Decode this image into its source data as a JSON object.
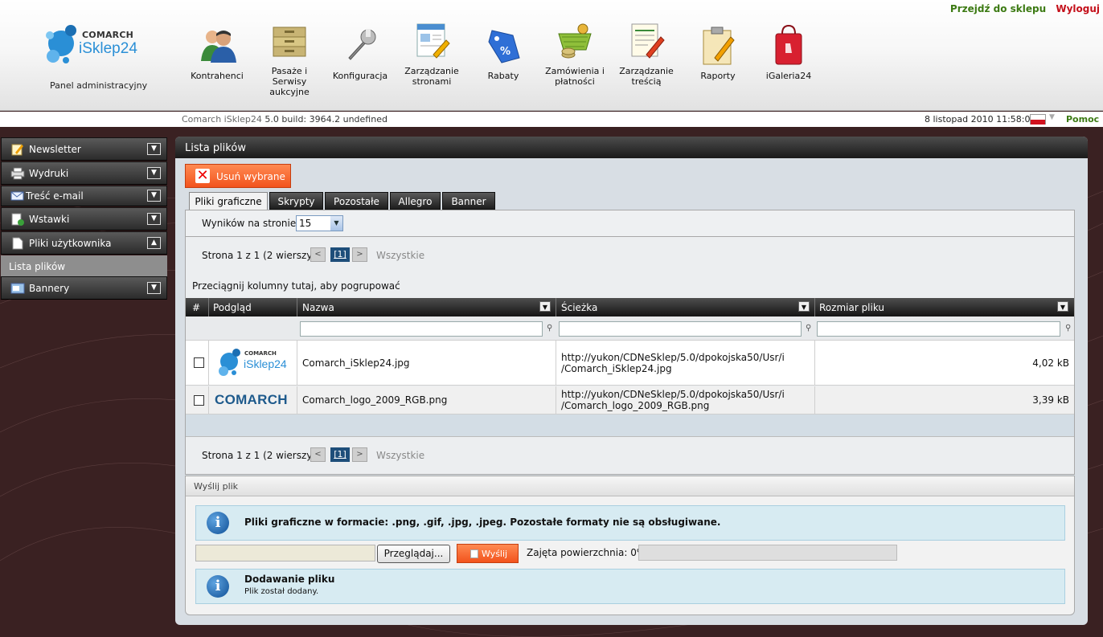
{
  "header": {
    "go_to_shop": "Przejdź do sklepu",
    "logout": "Wyloguj",
    "logo_brand": "COMARCH",
    "logo_name": "iSklep24",
    "panel_label": "Panel administracyjny"
  },
  "toolbar": [
    {
      "label": "Kontrahenci",
      "icon": "contacts-icon"
    },
    {
      "label": "Pasaże i Serwisy aukcyjne",
      "icon": "archive-icon"
    },
    {
      "label": "Konfiguracja",
      "icon": "wrench-icon"
    },
    {
      "label": "Zarządzanie stronami",
      "icon": "page-edit-icon"
    },
    {
      "label": "Rabaty",
      "icon": "discount-tag-icon"
    },
    {
      "label": "Zamówienia i płatności",
      "icon": "basket-icon"
    },
    {
      "label": "Zarządzanie treścią",
      "icon": "content-edit-icon"
    },
    {
      "label": "Raporty",
      "icon": "clipboard-icon"
    },
    {
      "label": "iGaleria24",
      "icon": "shopping-bag-icon"
    }
  ],
  "infobar": {
    "build_product": "Comarch iSklep24",
    "build_version": "5.0 build: 3964.2  undefined",
    "datetime": "8 listopad 2010 11:58:07",
    "help": "Pomoc"
  },
  "sidebar": {
    "items": [
      {
        "label": "Newsletter",
        "icon": "newsletter-icon",
        "expanded": false
      },
      {
        "label": "Wydruki",
        "icon": "printer-icon",
        "expanded": false
      },
      {
        "label": "Treść e-mail",
        "icon": "envelope-icon",
        "expanded": false
      },
      {
        "label": "Wstawki",
        "icon": "insert-icon",
        "expanded": false
      },
      {
        "label": "Pliki użytkownika",
        "icon": "file-icon",
        "expanded": true
      },
      {
        "label": "Bannery",
        "icon": "banner-icon",
        "expanded": false
      }
    ],
    "subitem": "Lista plików"
  },
  "main": {
    "title": "Lista plików",
    "delete_button": "Usuń wybrane",
    "tabs": [
      "Pliki graficzne",
      "Skrypty",
      "Pozostałe",
      "Allegro",
      "Banner"
    ],
    "active_tab": "Pliki graficzne",
    "per_page_label": "Wyników na stronie:",
    "per_page_value": "15",
    "pager": {
      "text": "Strona 1 z 1 (2 wierszy)",
      "current": "[1]",
      "all": "Wszystkie",
      "prev": "<",
      "next": ">"
    },
    "group_hint": "Przeciągnij kolumny tutaj, aby pogrupować",
    "columns": [
      "#",
      "Podgląd",
      "Nazwa",
      "Ścieżka",
      "Rozmiar pliku"
    ],
    "rows": [
      {
        "preview_brand": "COMARCH",
        "preview_name": "iSklep24",
        "name": "Comarch_iSklep24.jpg",
        "path1": "http://yukon/CDNeSklep/5.0/dpokojska50/Usr/i",
        "path2": "/Comarch_iSklep24.jpg",
        "size": "4,02 kB"
      },
      {
        "preview_brand": "COMARCH",
        "name": "Comarch_logo_2009_RGB.png",
        "path1": "http://yukon/CDNeSklep/5.0/dpokojska50/Usr/i",
        "path2": "/Comarch_logo_2009_RGB.png",
        "size": "3,39 kB"
      }
    ]
  },
  "upload": {
    "title": "Wyślij plik",
    "info": "Pliki graficzne w formacie: .png, .gif, .jpg, .jpeg. Pozostałe formaty nie są obsługiwane.",
    "browse": "Przeglądaj...",
    "send": "Wyślij",
    "usage_label": "Zajęta powierzchnia: 0%",
    "usage_fraction": 0,
    "success_title": "Dodawanie pliku",
    "success_text": "Plik został dodany."
  },
  "colors": {
    "accent_orange": "#f2531d",
    "link_green": "#3c7a13",
    "logout_red": "#c4101a",
    "brand_blue": "#2a8fd6"
  }
}
